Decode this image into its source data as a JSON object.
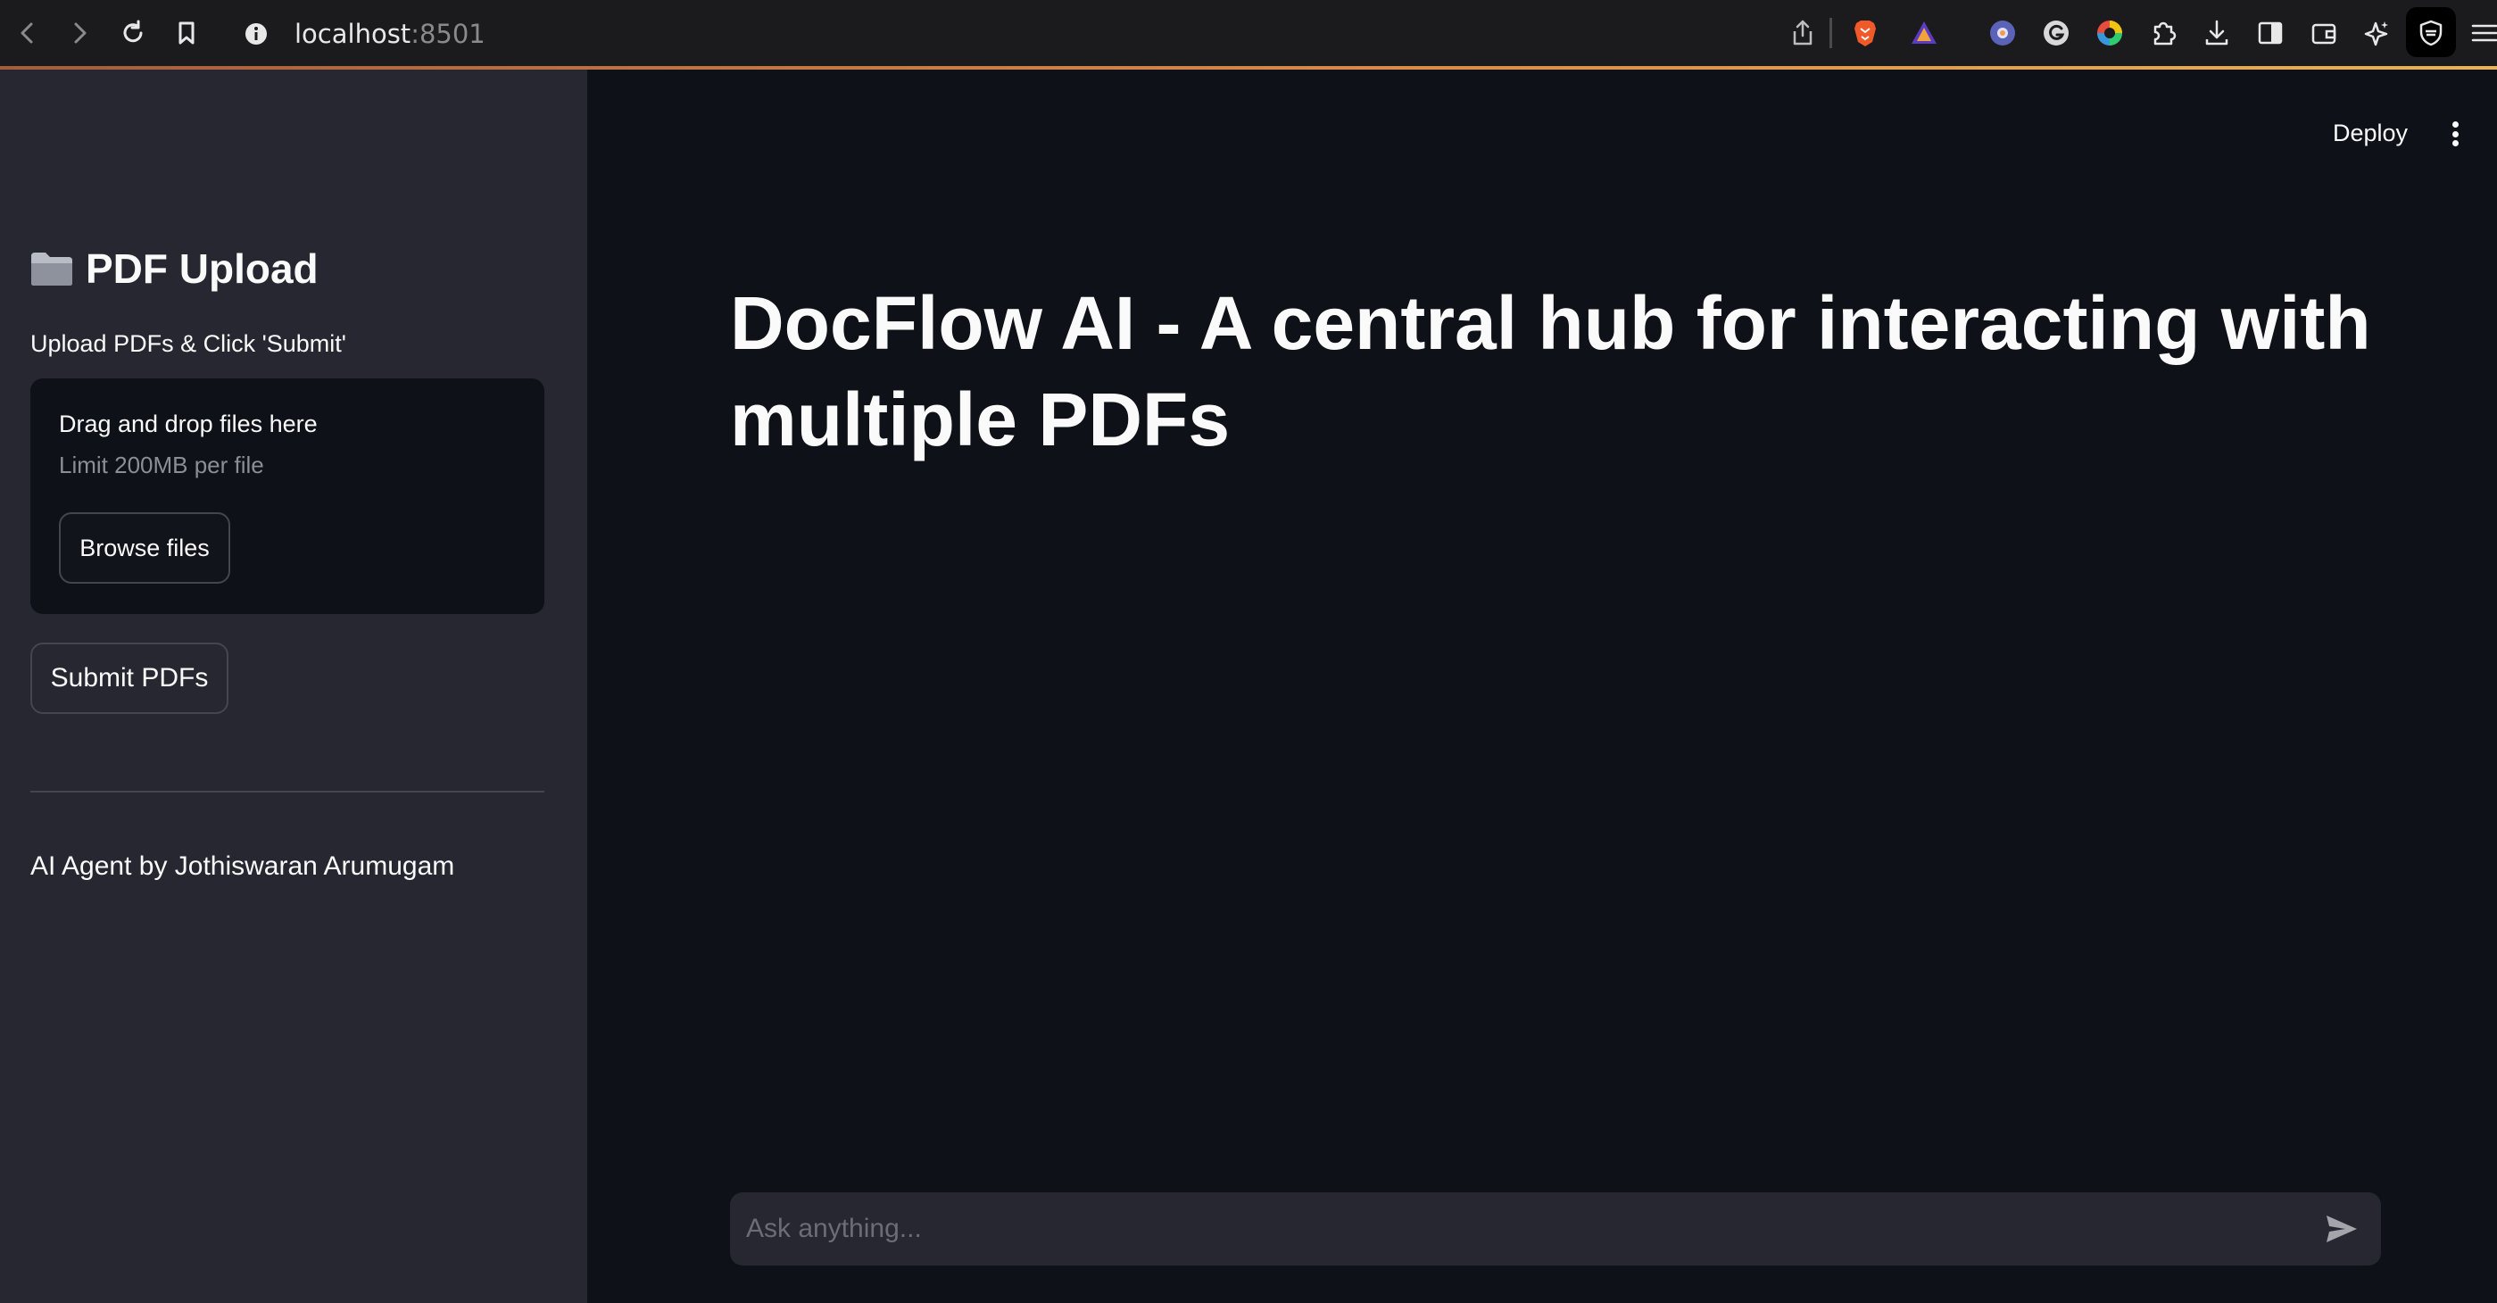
{
  "browser": {
    "url_host": "localhost",
    "url_port": ":8501",
    "icons": [
      "back-arrow-icon",
      "forward-arrow-icon",
      "reload-icon",
      "bookmark-icon",
      "info-icon",
      "share-icon",
      "brave-shields-icon",
      "brave-rewards-icon",
      "extension-icon",
      "grammarly-icon",
      "color-picker-icon",
      "puzzle-extensions-icon",
      "download-icon",
      "sidebar-toggle-icon",
      "wallet-icon",
      "leo-ai-icon",
      "vpn-shield-icon",
      "menu-icon"
    ]
  },
  "sidebar": {
    "title": "PDF Upload",
    "title_icon": "folder-icon",
    "upload_label": "Upload PDFs & Click 'Submit'",
    "dropzone": {
      "title": "Drag and drop files here",
      "limit": "Limit 200MB per file",
      "browse_label": "Browse files"
    },
    "submit_label": "Submit PDFs",
    "credit": "AI Agent by Jothiswaran Arumugam"
  },
  "header": {
    "deploy_label": "Deploy",
    "menu_icon": "kebab-menu-icon"
  },
  "main": {
    "title": "DocFlow AI - A central hub for interacting with multiple PDFs"
  },
  "chat": {
    "placeholder": "Ask anything...",
    "value": "",
    "send_icon": "send-icon"
  },
  "colors": {
    "background": "#0e1117",
    "sidebar": "#262730",
    "accent_line": "#d98a4a"
  }
}
